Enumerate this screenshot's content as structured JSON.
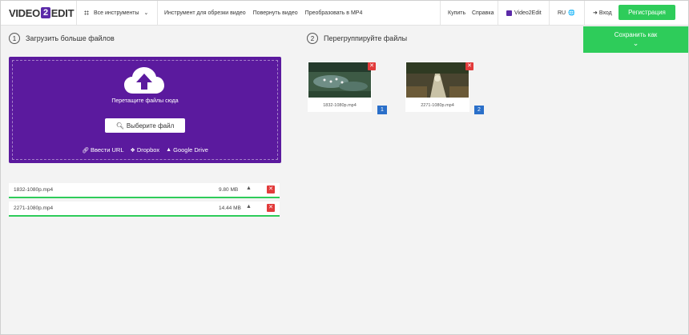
{
  "header": {
    "logo_left": "VIDEO",
    "logo_mid": "2",
    "logo_right": "EDIT",
    "tools_label": "Все инструменты",
    "links": [
      "Инструмент для обрезки видео",
      "Повернуть видео",
      "Преобразовать в MP4"
    ],
    "buy": "Купить",
    "help": "Справка",
    "brand_link": "Video2Edit",
    "lang": "RU",
    "login": "Вход",
    "register": "Регистрация"
  },
  "left": {
    "step": "1",
    "title": "Загрузить больше файлов",
    "drop_text": "Перетащите файлы сюда",
    "choose_label": "Выберите файл",
    "sources": {
      "url": "Ввести URL",
      "dropbox": "Dropbox",
      "gdrive": "Google Drive"
    }
  },
  "files": [
    {
      "name": "1832-1080p.mp4",
      "size": "9.80 MB"
    },
    {
      "name": "2271-1080p.mp4",
      "size": "14.44 MB"
    }
  ],
  "right": {
    "step": "2",
    "title": "Перегруппируйте файлы",
    "save_label": "Сохранить как",
    "thumbnails": [
      {
        "caption": "1832-1080p.mp4",
        "order": "1"
      },
      {
        "caption": "2271-1080p.mp4",
        "order": "2"
      }
    ]
  },
  "icons": {
    "grid": "grid-icon",
    "chevron": "chevron-down-icon",
    "globe": "globe-icon",
    "login": "sign-in-icon",
    "upload": "cloud-upload-icon",
    "search": "search-icon",
    "link": "link-icon",
    "dropbox": "dropbox-icon",
    "gdrive": "google-drive-icon",
    "close": "close-icon"
  },
  "colors": {
    "accent_purple": "#5b1a9e",
    "green": "#2ecc5a",
    "red": "#e23b3b",
    "blue": "#2a6fc9"
  }
}
